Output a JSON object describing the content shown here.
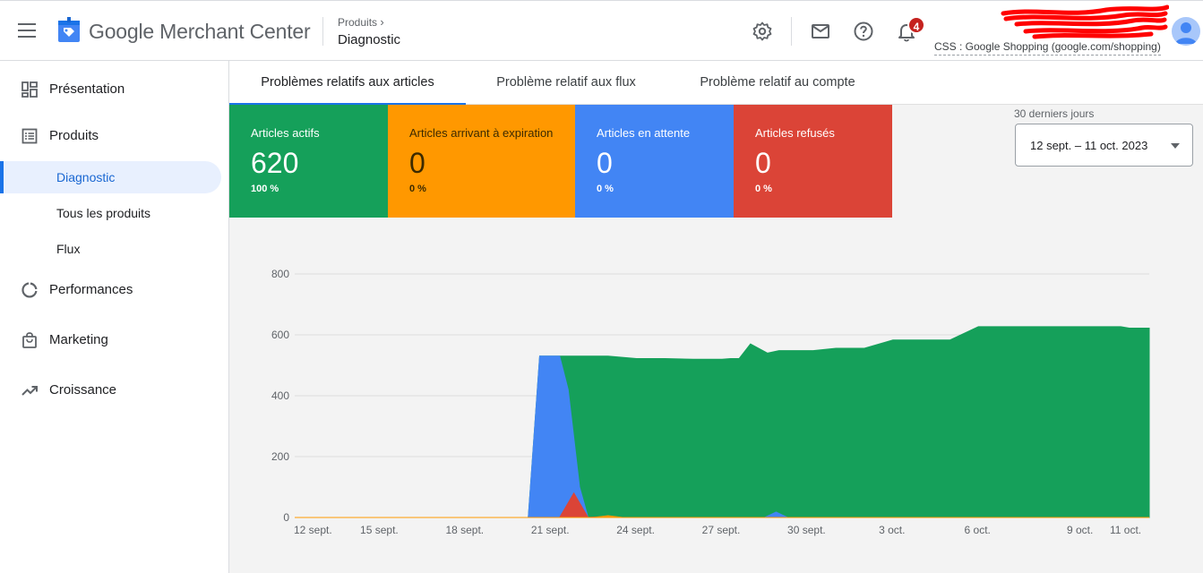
{
  "header": {
    "brand_google": "Google",
    "brand_product": "Merchant Center",
    "breadcrumb_parent": "Produits",
    "breadcrumb_current": "Diagnostic",
    "notification_count": "4",
    "account_label": "CSS : Google Shopping (google.com/shopping)",
    "icons": [
      "menu-icon",
      "merchant-logo-icon",
      "settings-icon",
      "mail-icon",
      "help-icon",
      "notifications-icon",
      "account-avatar"
    ]
  },
  "sidebar": {
    "items": [
      {
        "label": "Présentation",
        "icon": "dashboard-icon"
      },
      {
        "label": "Produits",
        "icon": "list-icon"
      },
      {
        "label": "Diagnostic",
        "sub": true,
        "active": true
      },
      {
        "label": "Tous les produits",
        "sub": true
      },
      {
        "label": "Flux",
        "sub": true
      },
      {
        "label": "Performances",
        "icon": "donut-chart-icon"
      },
      {
        "label": "Marketing",
        "icon": "shopping-bag-icon"
      },
      {
        "label": "Croissance",
        "icon": "trending-up-icon"
      }
    ]
  },
  "tabs": [
    {
      "label": "Problèmes relatifs aux articles",
      "active": true
    },
    {
      "label": "Problème relatif aux flux"
    },
    {
      "label": "Problème relatif au compte"
    }
  ],
  "cards": [
    {
      "title": "Articles actifs",
      "value": "620",
      "percent": "100 %",
      "color": "#15a05a"
    },
    {
      "title": "Articles arrivant à expiration",
      "value": "0",
      "percent": "0 %",
      "color": "#ff9800"
    },
    {
      "title": "Articles en attente",
      "value": "0",
      "percent": "0 %",
      "color": "#4285f4"
    },
    {
      "title": "Articles refusés",
      "value": "0",
      "percent": "0 %",
      "color": "#db4437"
    }
  ],
  "date_range": {
    "label": "30 derniers jours",
    "value": "12 sept. – 11 oct. 2023"
  },
  "chart_data": {
    "type": "area",
    "title": "",
    "xlabel": "",
    "ylabel": "",
    "ylim": [
      0,
      800
    ],
    "yticks": [
      0,
      200,
      400,
      600,
      800
    ],
    "x_tick_labels": [
      "12 sept.",
      "15 sept.",
      "18 sept.",
      "21 sept.",
      "24 sept.",
      "27 sept.",
      "30 sept.",
      "3 oct.",
      "6 oct.",
      "9 oct.",
      "11 oct."
    ],
    "grid": true,
    "series": [
      {
        "color": "#15a05a",
        "x": [
          0,
          8.2,
          8.6,
          9.3,
          10,
          11,
          12,
          13,
          14,
          14.6,
          15,
          15.3,
          15.6,
          16,
          16.6,
          17,
          18,
          18.2,
          19,
          20,
          21,
          21.3,
          22,
          23,
          24,
          25,
          26,
          27,
          28,
          29,
          29.3,
          29.6,
          30
        ],
        "values": [
          0,
          0,
          530,
          530,
          530,
          530,
          522,
          522,
          520,
          520,
          520,
          522,
          522,
          570,
          540,
          548,
          548,
          548,
          556,
          556,
          583,
          583,
          583,
          583,
          627,
          627,
          627,
          627,
          627,
          627,
          622,
          622,
          622
        ]
      },
      {
        "color": "#4285f4",
        "x": [
          0,
          8.2,
          8.6,
          9.3,
          9.6,
          10,
          10.3,
          16.5,
          16.9,
          17.3,
          30
        ],
        "values": [
          0,
          0,
          530,
          530,
          420,
          100,
          0,
          0,
          18,
          0,
          0
        ]
      },
      {
        "color": "#db4437",
        "x": [
          0,
          9.3,
          9.8,
          10.3,
          11,
          11.5,
          12,
          30
        ],
        "values": [
          0,
          0,
          80,
          0,
          4,
          0,
          0,
          0
        ]
      },
      {
        "color": "#ff9800",
        "x": [
          0,
          10.5,
          11,
          11.5,
          30
        ],
        "values": [
          0,
          0,
          6,
          0,
          0
        ]
      }
    ]
  }
}
